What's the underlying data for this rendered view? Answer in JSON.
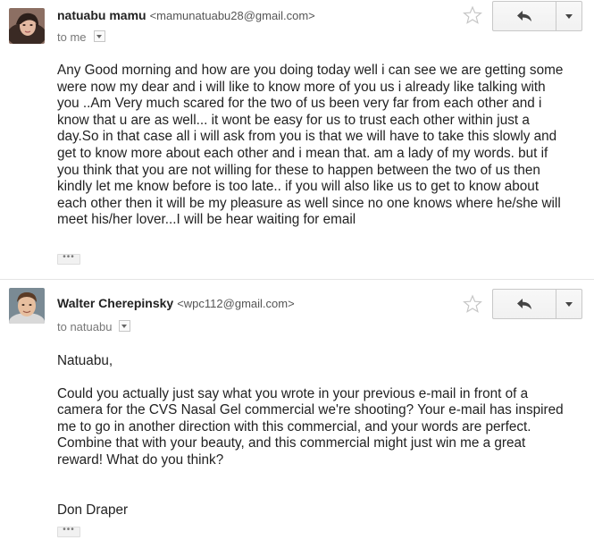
{
  "colors": {
    "accent_text": "#222222",
    "muted_text": "#777777",
    "border": "#c8c8c8"
  },
  "messages": [
    {
      "sender_name": "natuabu mamu",
      "sender_email": "<mamunatuabu28@gmail.com>",
      "to_line": "to me",
      "avatar_icon": "woman-avatar",
      "star_icon": "star-outline-icon",
      "reply_icon": "reply-arrow-icon",
      "more_icon": "chevron-down-icon",
      "body": [
        "Any Good morning and how are you doing today well i can see we are getting some were now my dear and i will like to know more of you us i already like talking with you ..Am Very much scared for the two of us been very far from each other and i know that u are as well... it wont be easy for us to trust each other within just a day.So in that case all i will ask from you is that we will have to take this slowly and get to know more about each other and i mean that. am a lady of my words. but if you think that you are not willing for these to happen between the two of us then kindly let me know before is too late.. if you will also like us to get to know about each other then it will be my pleasure as well since no one knows where he/she will meet his/her lover...I will be hear waiting for email"
      ],
      "trimmed_content_label": "•••"
    },
    {
      "sender_name": "Walter Cherepinsky",
      "sender_email": "<wpc112@gmail.com>",
      "to_line": "to natuabu",
      "avatar_icon": "man-avatar",
      "star_icon": "star-outline-icon",
      "reply_icon": "reply-arrow-icon",
      "more_icon": "chevron-down-icon",
      "body": [
        "Natuabu,",
        "Could you actually just say what you wrote in your previous e-mail in front of a camera for the CVS Nasal Gel commercial we're shooting? Your e-mail has inspired me to go in another direction with this commercial, and your words are perfect. Combine that with your beauty, and this commercial might just win me a great reward! What do you think?",
        "Don Draper"
      ],
      "trimmed_content_label": "•••"
    }
  ]
}
